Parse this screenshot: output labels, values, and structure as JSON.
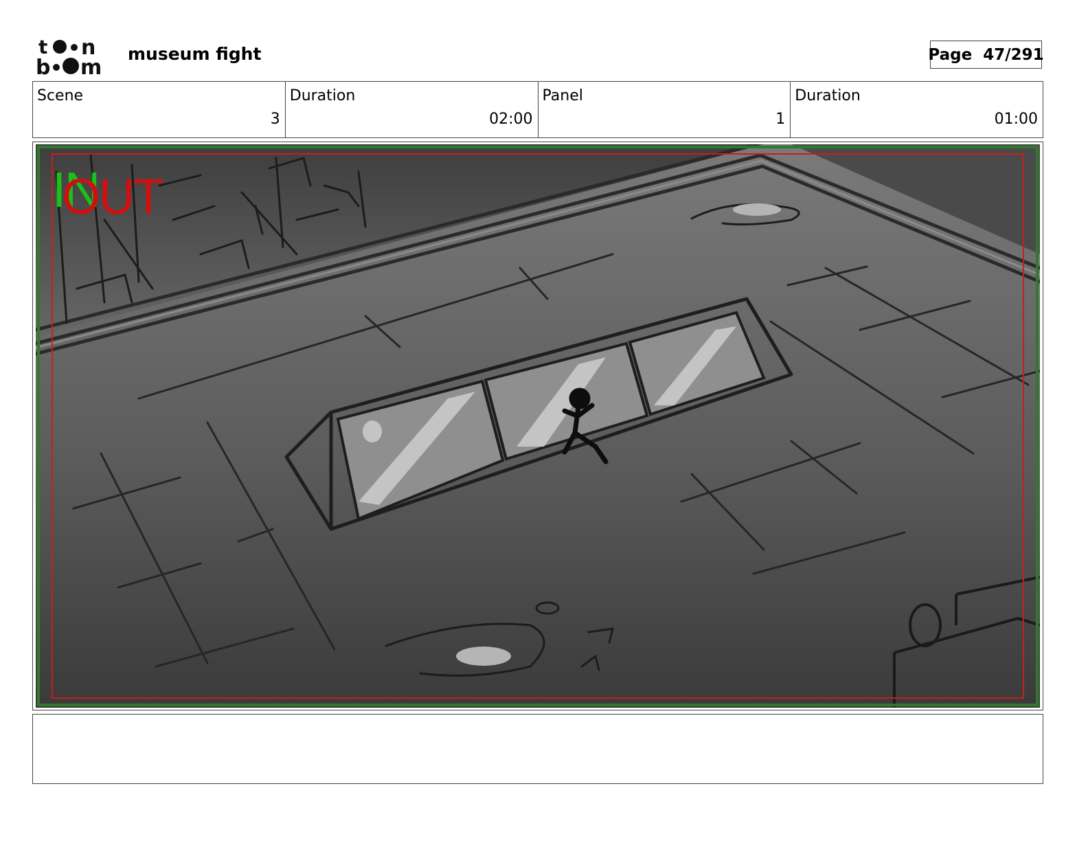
{
  "header": {
    "brand": "toon boom",
    "title": "museum fight",
    "page": "Page  47/291"
  },
  "info": [
    {
      "label": "Scene",
      "value": "3"
    },
    {
      "label": "Duration",
      "value": "02:00"
    },
    {
      "label": "Panel",
      "value": "1"
    },
    {
      "label": "Duration",
      "value": "01:00"
    }
  ],
  "panel": {
    "in_label": "IN",
    "out_label": "OUT",
    "colors": {
      "in": "#19c219",
      "out": "#d01010",
      "title_safe": "#c81e1e",
      "action_safe": "#2f7a2f"
    }
  },
  "notes": {
    "text": ""
  }
}
